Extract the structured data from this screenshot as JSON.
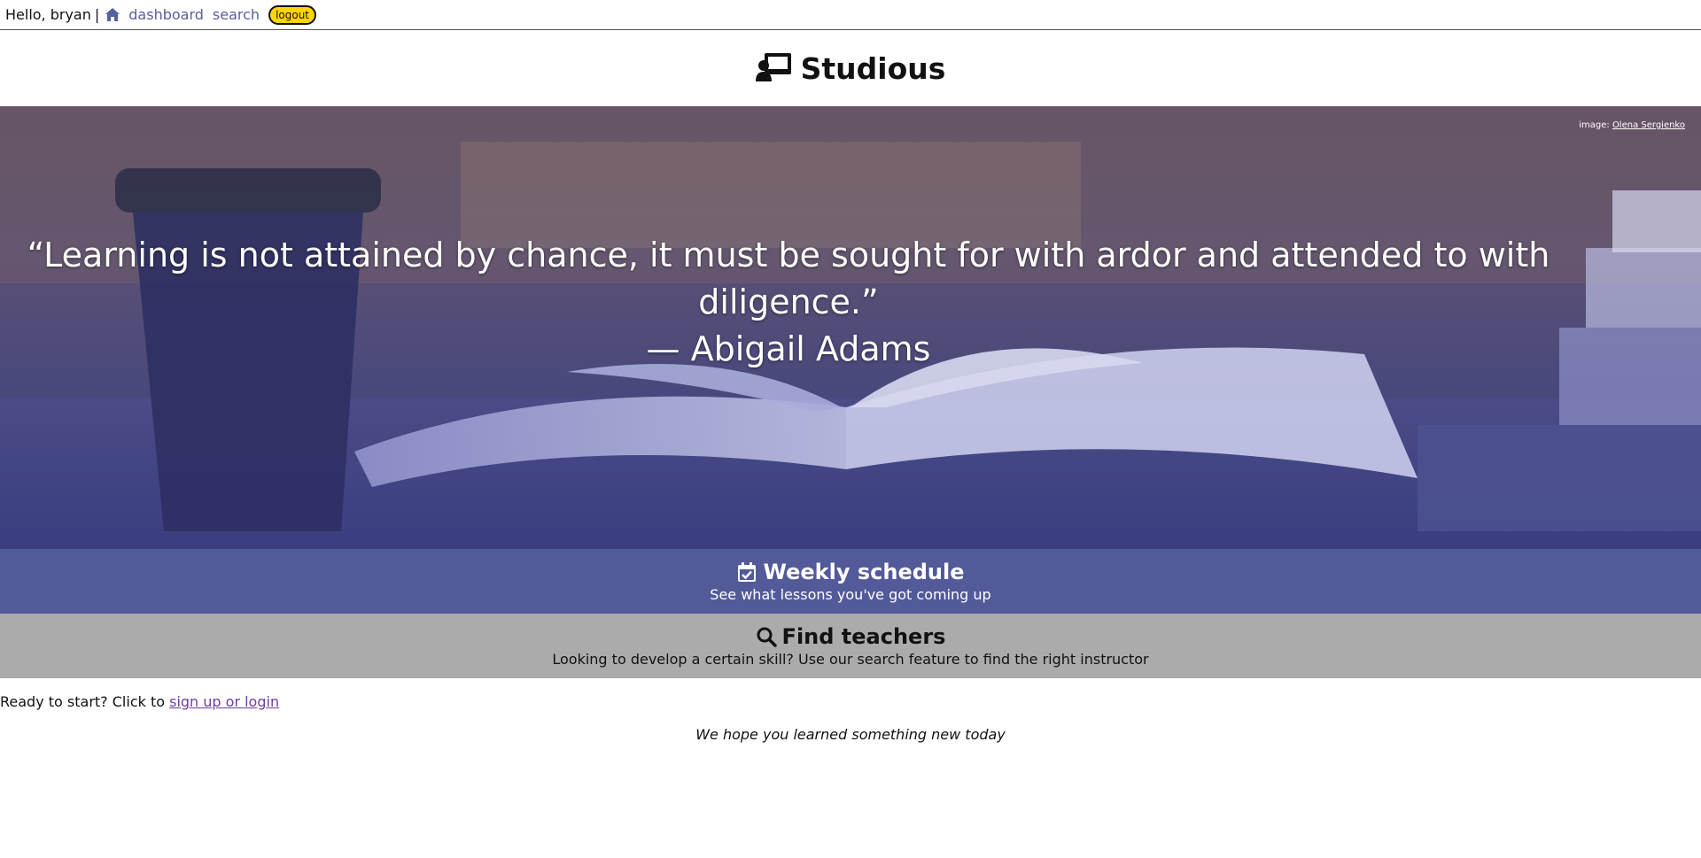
{
  "nav": {
    "greeting": "Hello, bryan",
    "separator": "|",
    "home_icon": "home-icon",
    "dashboard_label": "dashboard",
    "search_label": "search",
    "logout_label": "logout",
    "link_color": "#5560a0",
    "logout_color": "#ffd500"
  },
  "brand": {
    "logo_icon": "teacher-board-icon",
    "title": "Studious"
  },
  "hero": {
    "credit_prefix": "image:",
    "credit_name": "Olena Sergienko",
    "quote_line1": "“Learning is not attained by chance, it must be sought for with ardor and attended to with diligence.”",
    "quote_line2": "— Abigail Adams"
  },
  "features": {
    "schedule": {
      "icon": "calendar-check-icon",
      "title": "Weekly schedule",
      "subtitle": "See what lessons you've got coming up",
      "color": "#525a9a"
    },
    "teachers": {
      "icon": "search-icon",
      "title": "Find teachers",
      "subtitle": "Looking to develop a certain skill? Use our search feature to find the right instructor",
      "color": "#ababab"
    }
  },
  "footer": {
    "ready_text": "Ready to start? Click to ",
    "ready_link": "sign up or login",
    "closing": "We hope you learned something new today"
  }
}
